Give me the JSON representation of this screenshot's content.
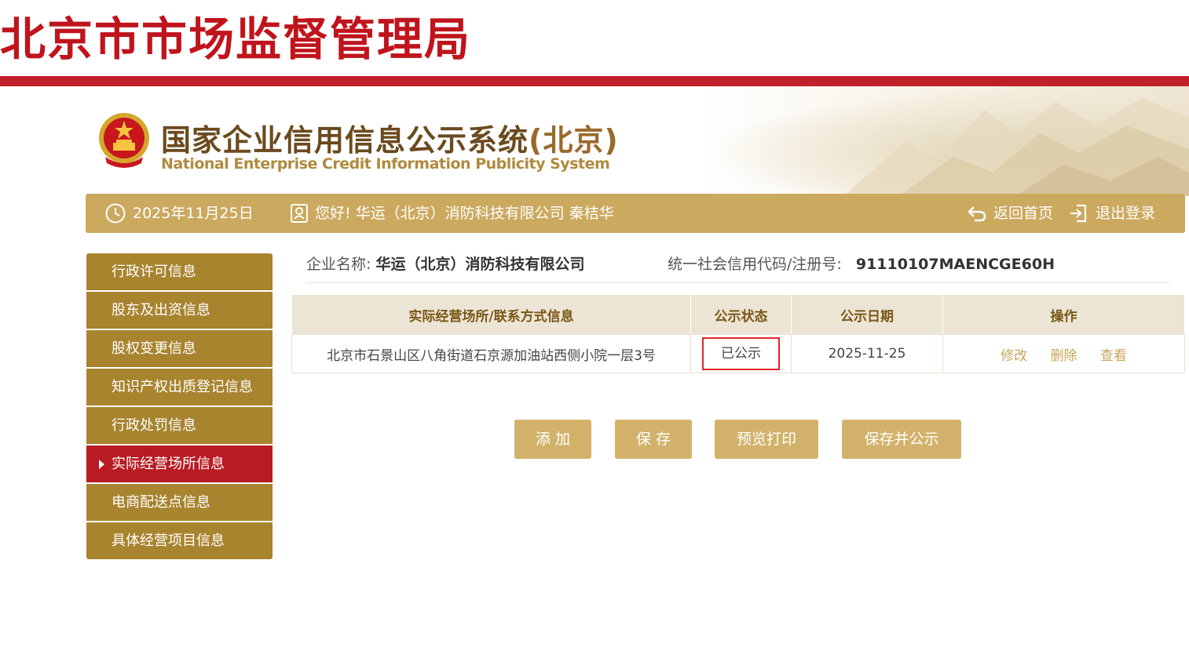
{
  "agency": {
    "title": "北京市市场监督管理局"
  },
  "system": {
    "title": "国家企业信用信息公示系统",
    "title_region": "(北京)",
    "subtitle": "National Enterprise Credit Information Publicity System"
  },
  "info_bar": {
    "date": "2025年11月25日",
    "greeting": "您好! 华运（北京）消防科技有限公司 秦桔华",
    "home_label": "返回首页",
    "logout_label": "退出登录"
  },
  "sidebar": {
    "items": [
      {
        "label": "行政许可信息",
        "active": false
      },
      {
        "label": "股东及出资信息",
        "active": false
      },
      {
        "label": "股权变更信息",
        "active": false
      },
      {
        "label": "知识产权出质登记信息",
        "active": false
      },
      {
        "label": "行政处罚信息",
        "active": false
      },
      {
        "label": "实际经营场所信息",
        "active": true
      },
      {
        "label": "电商配送点信息",
        "active": false
      },
      {
        "label": "具体经营项目信息",
        "active": false
      }
    ]
  },
  "company": {
    "name_label": "企业名称:",
    "name": "华运（北京）消防科技有限公司",
    "code_label": "统一社会信用代码/注册号:",
    "code": "91110107MAENCGE60H"
  },
  "table": {
    "headers": [
      "实际经营场所/联系方式信息",
      "公示状态",
      "公示日期",
      "操作"
    ],
    "rows": [
      {
        "address": "北京市石景山区八角街道石京源加油站西侧小院一层3号",
        "status": "已公示",
        "date": "2025-11-25",
        "actions": [
          "修改",
          "删除",
          "查看"
        ]
      }
    ]
  },
  "buttons": {
    "add": "添 加",
    "save": "保 存",
    "preview_print": "预览打印",
    "save_publish": "保存并公示"
  },
  "colors": {
    "brand_red": "#c0141c",
    "gold": "#cba95f",
    "sidebar_gold": "#a8842f",
    "active_red": "#b81c22",
    "status_border": "#e0262a"
  }
}
